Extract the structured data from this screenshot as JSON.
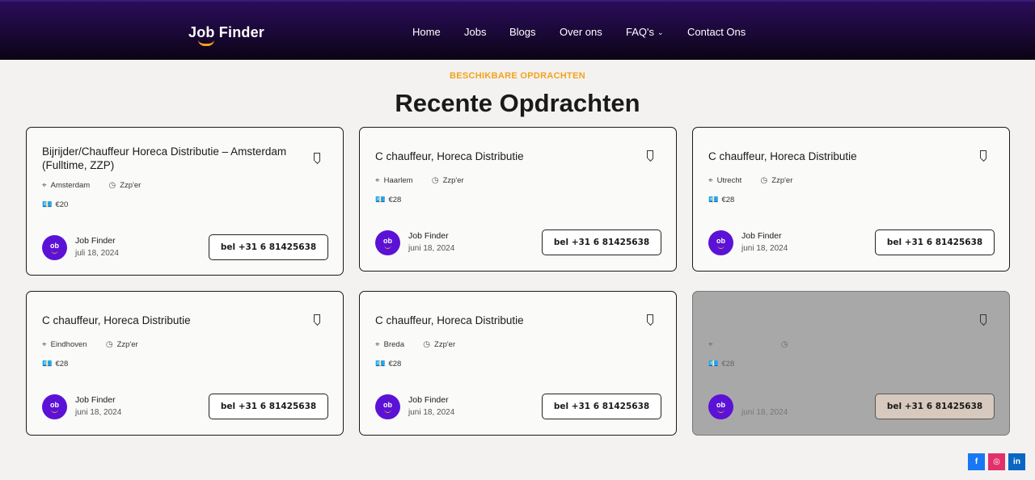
{
  "header": {
    "logo": "Job Finder",
    "nav": [
      {
        "label": "Home"
      },
      {
        "label": "Jobs"
      },
      {
        "label": "Blogs"
      },
      {
        "label": "Over ons"
      },
      {
        "label": "FAQ's",
        "has_dropdown": true
      },
      {
        "label": "Contact Ons"
      }
    ]
  },
  "section": {
    "eyebrow": "BESCHIKBARE OPDRACHTEN",
    "title": "Recente Opdrachten"
  },
  "cards": [
    {
      "title": "Bijrijder/Chauffeur Horeca Distributie – Amsterdam (Fulltime, ZZP)",
      "location": "Amsterdam",
      "type": "Zzp'er",
      "salary": "€20",
      "company": "Job Finder",
      "date": "juli 18, 2024",
      "button": "bel +31 6 81425638",
      "avatar_text": "ob"
    },
    {
      "title": "C chauffeur, Horeca Distributie",
      "location": "Haarlem",
      "type": "Zzp'er",
      "salary": "€28",
      "company": "Job Finder",
      "date": "juni 18, 2024",
      "button": "bel +31 6 81425638",
      "avatar_text": "ob"
    },
    {
      "title": "C chauffeur, Horeca Distributie",
      "location": "Utrecht",
      "type": "Zzp'er",
      "salary": "€28",
      "company": "Job Finder",
      "date": "juni 18, 2024",
      "button": "bel +31 6 81425638",
      "avatar_text": "ob"
    },
    {
      "title": "C chauffeur, Horeca Distributie",
      "location": "Eindhoven",
      "type": "Zzp'er",
      "salary": "€28",
      "company": "Job Finder",
      "date": "juni 18, 2024",
      "button": "bel +31 6 81425638",
      "avatar_text": "ob"
    },
    {
      "title": "C chauffeur, Horeca Distributie",
      "location": "Breda",
      "type": "Zzp'er",
      "salary": "€28",
      "company": "Job Finder",
      "date": "juni 18, 2024",
      "button": "bel +31 6 81425638",
      "avatar_text": "ob"
    },
    {
      "title": "",
      "location": "",
      "type": "",
      "salary": "€28",
      "company": "",
      "date": "juni 18, 2024",
      "button": "bel +31 6 81425638",
      "avatar_text": "ob"
    }
  ],
  "social": [
    {
      "label": "f",
      "icon": "facebook-icon",
      "color": "#1877f2"
    },
    {
      "label": "◎",
      "icon": "instagram-icon",
      "color": "#e1306c"
    },
    {
      "label": "in",
      "icon": "linkedin-icon",
      "color": "#0a66c2"
    }
  ],
  "colors": {
    "accent": "#f5a21a",
    "brand": "#5b12d6",
    "header": "#1a0836"
  }
}
